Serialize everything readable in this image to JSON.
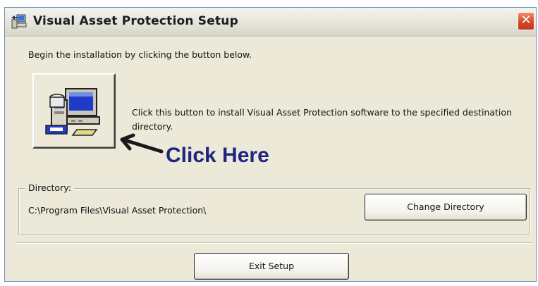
{
  "window": {
    "title": "Visual Asset Protection Setup",
    "close_label": "✕",
    "colors": {
      "titlebar": "#e4e3d9",
      "close": "#d8482a",
      "face": "#ece9d8",
      "callout": "#1f2680"
    }
  },
  "main": {
    "intro_text": "Begin the installation by clicking the button below.",
    "install_button_icon": "computer-setup-icon",
    "install_description": "Click this button to install Visual Asset Protection software to the specified destination directory.",
    "callout_text": "Click Here"
  },
  "directory": {
    "group_label": "Directory:",
    "path": "C:\\Program Files\\Visual Asset Protection\\",
    "change_button_label": "Change Directory"
  },
  "footer": {
    "exit_button_label": "Exit Setup"
  }
}
